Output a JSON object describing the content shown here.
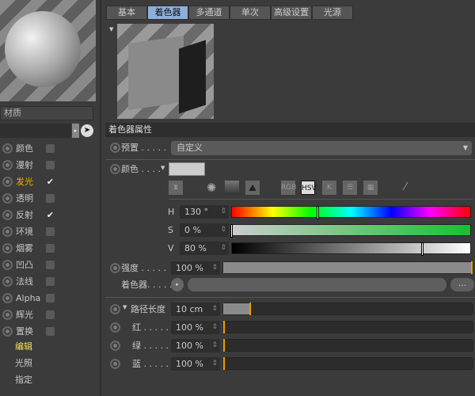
{
  "left_panel": {
    "name_label": "材质",
    "channels": [
      {
        "label": "颜色",
        "checked": false,
        "active": false
      },
      {
        "label": "漫射",
        "checked": false,
        "active": false
      },
      {
        "label": "发光",
        "checked": true,
        "active": true
      },
      {
        "label": "透明",
        "checked": false,
        "active": false
      },
      {
        "label": "反射",
        "checked": true,
        "active": false
      },
      {
        "label": "环境",
        "checked": false,
        "active": false
      },
      {
        "label": "烟雾",
        "checked": false,
        "active": false
      },
      {
        "label": "凹凸",
        "checked": false,
        "active": false
      },
      {
        "label": "法线",
        "checked": false,
        "active": false
      },
      {
        "label": "Alpha",
        "checked": false,
        "active": false
      },
      {
        "label": "辉光",
        "checked": false,
        "active": false
      },
      {
        "label": "置换",
        "checked": false,
        "active": false
      }
    ],
    "extras": [
      "编辑",
      "光照",
      "指定"
    ]
  },
  "tabs": [
    {
      "label": "基本"
    },
    {
      "label": "着色器",
      "active": true
    },
    {
      "label": "多通道"
    },
    {
      "label": "单次"
    },
    {
      "label": "高级设置"
    },
    {
      "label": "光源"
    }
  ],
  "section_title": "着色器属性",
  "preset": {
    "label": "预置 . . . . .",
    "value": "自定义"
  },
  "color": {
    "label": "颜色 . . . .",
    "swatch": "#cccccc",
    "modes": [
      "RGB",
      "HSV",
      "K"
    ],
    "active_mode": "HSV",
    "h": {
      "label": "H",
      "value": "130 °",
      "fraction": 0.361
    },
    "s": {
      "label": "S",
      "value": "0 %",
      "fraction": 0
    },
    "v": {
      "label": "V",
      "value": "80 %",
      "fraction": 0.8
    }
  },
  "strength": {
    "label": "强度 . . . . .",
    "value": "100 %",
    "fraction": 1.0
  },
  "shader": {
    "label": "着色器. . . . .",
    "more": "..."
  },
  "path_length": {
    "label": "路径长度",
    "value": "10 cm",
    "fraction": 0.11
  },
  "red": {
    "label": "红 . . . . .",
    "value": "100 %"
  },
  "green": {
    "label": "绿 . . . . .",
    "value": "100 %"
  },
  "blue": {
    "label": "蓝 . . . . .",
    "value": "100 %"
  },
  "accent": "#f0a000"
}
